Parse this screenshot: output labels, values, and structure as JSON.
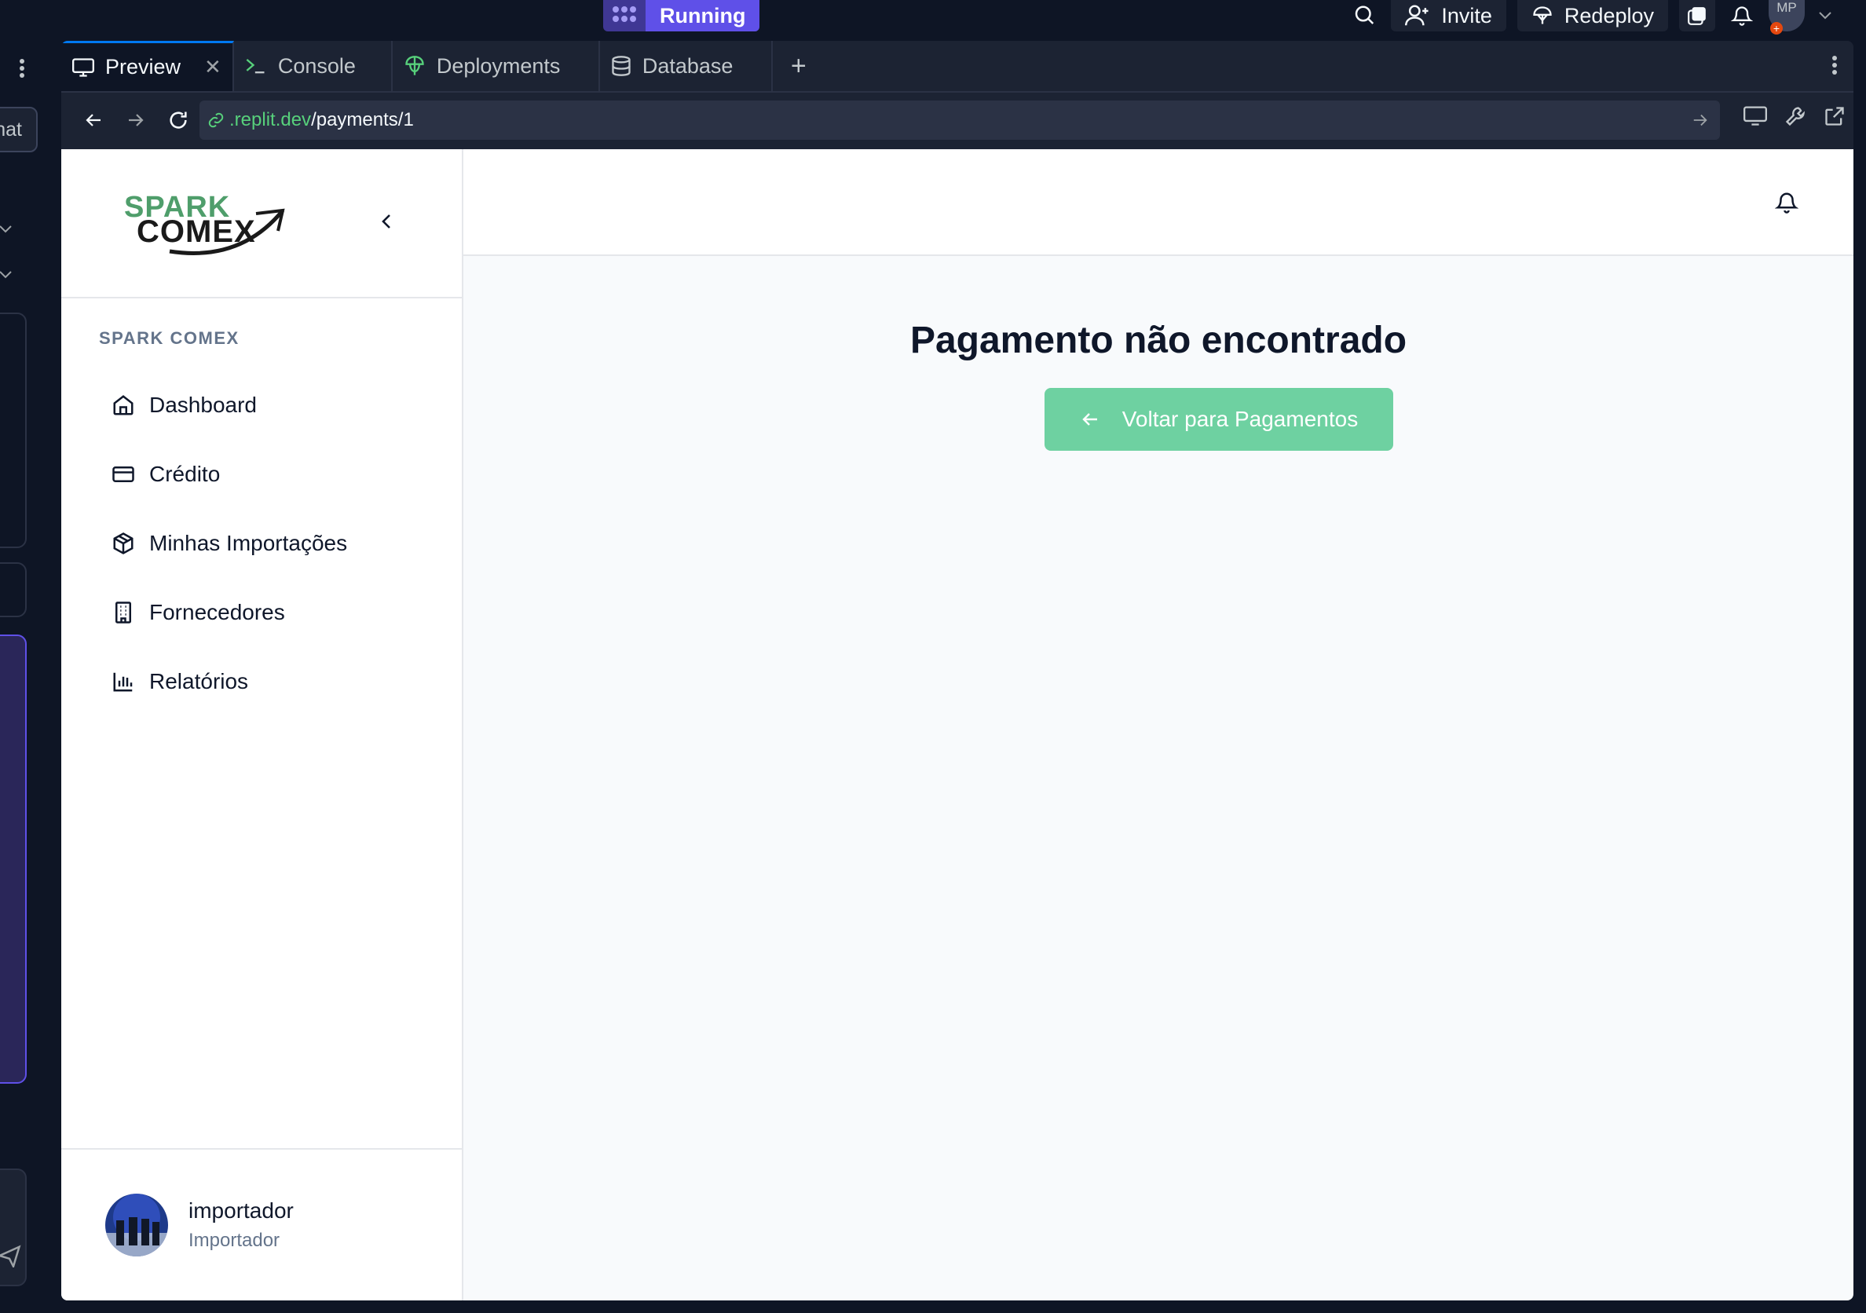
{
  "topbar": {
    "run_label": "Running",
    "invite_label": "Invite",
    "redeploy_label": "Redeploy",
    "avatar_initials": "MP"
  },
  "leftstrip": {
    "chat_label": "hat"
  },
  "tabs": [
    {
      "label": "Preview",
      "icon": "monitor-icon"
    },
    {
      "label": "Console",
      "icon": "terminal-icon"
    },
    {
      "label": "Deployments",
      "icon": "globe-icon"
    },
    {
      "label": "Database",
      "icon": "database-icon"
    }
  ],
  "url": {
    "host": ".replit.dev",
    "path": "/payments/1"
  },
  "app": {
    "section_label": "SPARK COMEX",
    "nav": [
      {
        "label": "Dashboard",
        "icon": "home-icon"
      },
      {
        "label": "Crédito",
        "icon": "credit-card-icon"
      },
      {
        "label": "Minhas Importações",
        "icon": "package-icon"
      },
      {
        "label": "Fornecedores",
        "icon": "building-icon"
      },
      {
        "label": "Relatórios",
        "icon": "bar-chart-icon"
      }
    ],
    "user": {
      "name": "importador",
      "role": "Importador"
    },
    "message": "Pagamento não encontrado",
    "back_button": "Voltar para Pagamentos",
    "logo": {
      "top": "SPARK",
      "bottom": "COMEX"
    }
  },
  "colors": {
    "brand_green": "#4f9e6b",
    "button_green": "#6ed1a1",
    "accent": "#5f50e8"
  }
}
